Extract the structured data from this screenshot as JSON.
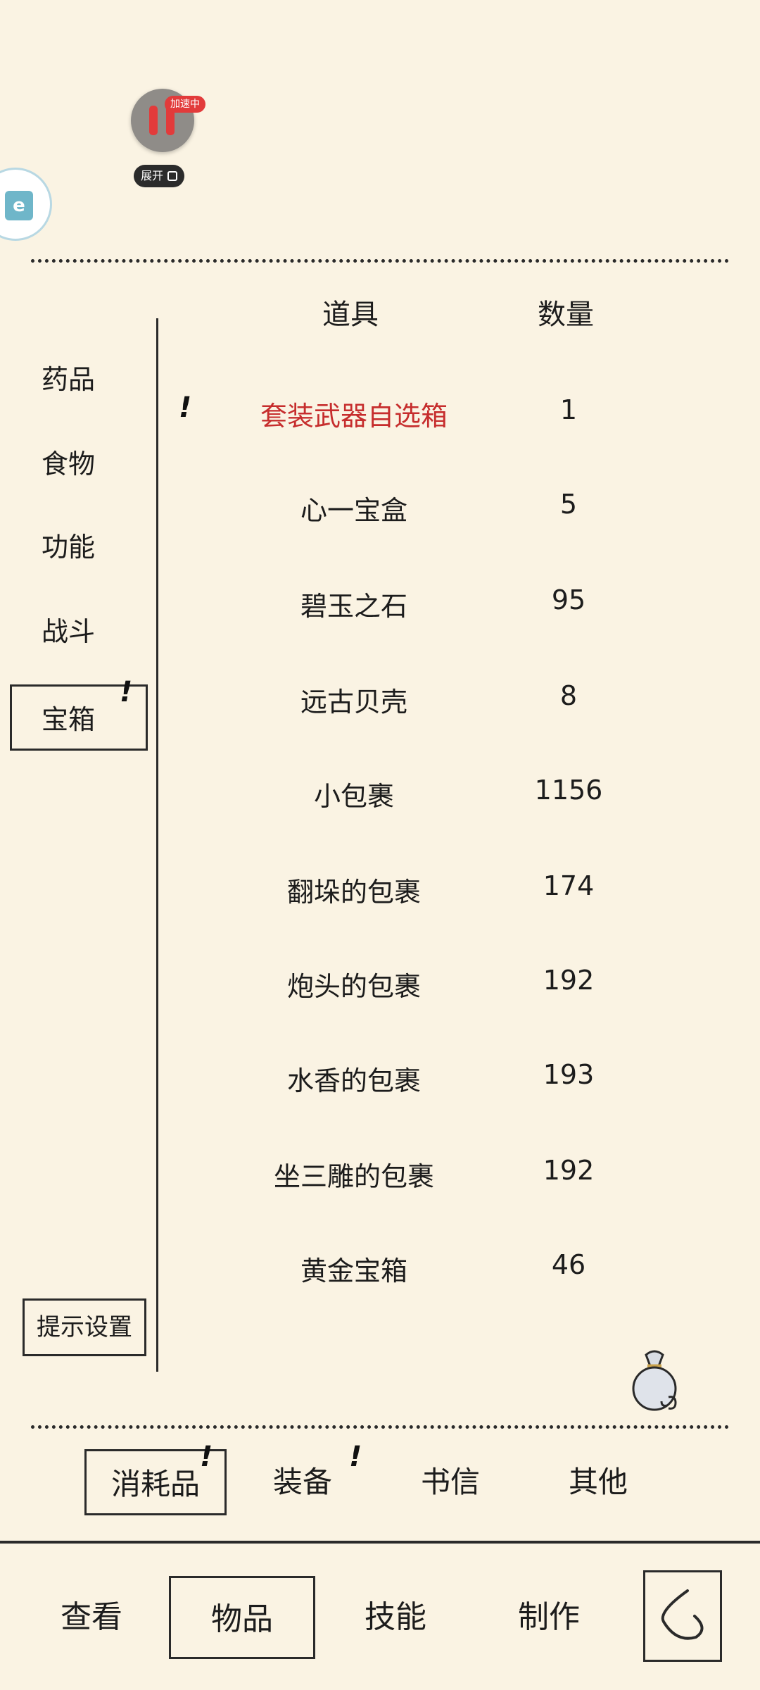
{
  "overlay": {
    "speed_badge": "加速中",
    "expand_label": "展开",
    "side_app_logo": "e",
    "icons": [
      "pause-icon",
      "expand-icon",
      "app-icon"
    ]
  },
  "categories": {
    "items": [
      "药品",
      "食物",
      "功能",
      "战斗",
      "宝箱"
    ],
    "selected": "宝箱",
    "hint_settings": "提示设置"
  },
  "table": {
    "header_item": "道具",
    "header_qty": "数量",
    "rows": [
      {
        "name": "套装武器自选箱",
        "qty": "1"
      },
      {
        "name": "心一宝盒",
        "qty": "5"
      },
      {
        "name": "碧玉之石",
        "qty": "95"
      },
      {
        "name": "远古贝壳",
        "qty": "8"
      },
      {
        "name": "小包裹",
        "qty": "1156"
      },
      {
        "name": "翻垛的包裹",
        "qty": "174"
      },
      {
        "name": "炮头的包裹",
        "qty": "192"
      },
      {
        "name": "水香的包裹",
        "qty": "193"
      },
      {
        "name": "坐三雕的包裹",
        "qty": "192"
      },
      {
        "name": "黄金宝箱",
        "qty": "46"
      }
    ]
  },
  "marks": {
    "exclamation": "!"
  },
  "subtabs": [
    "消耗品",
    "装备",
    "书信",
    "其他"
  ],
  "nav": [
    "查看",
    "物品",
    "技能",
    "制作"
  ],
  "colors": {
    "background": "#faf3e3",
    "highlight_red": "#c62d2d",
    "ink": "#2a2a2a"
  }
}
